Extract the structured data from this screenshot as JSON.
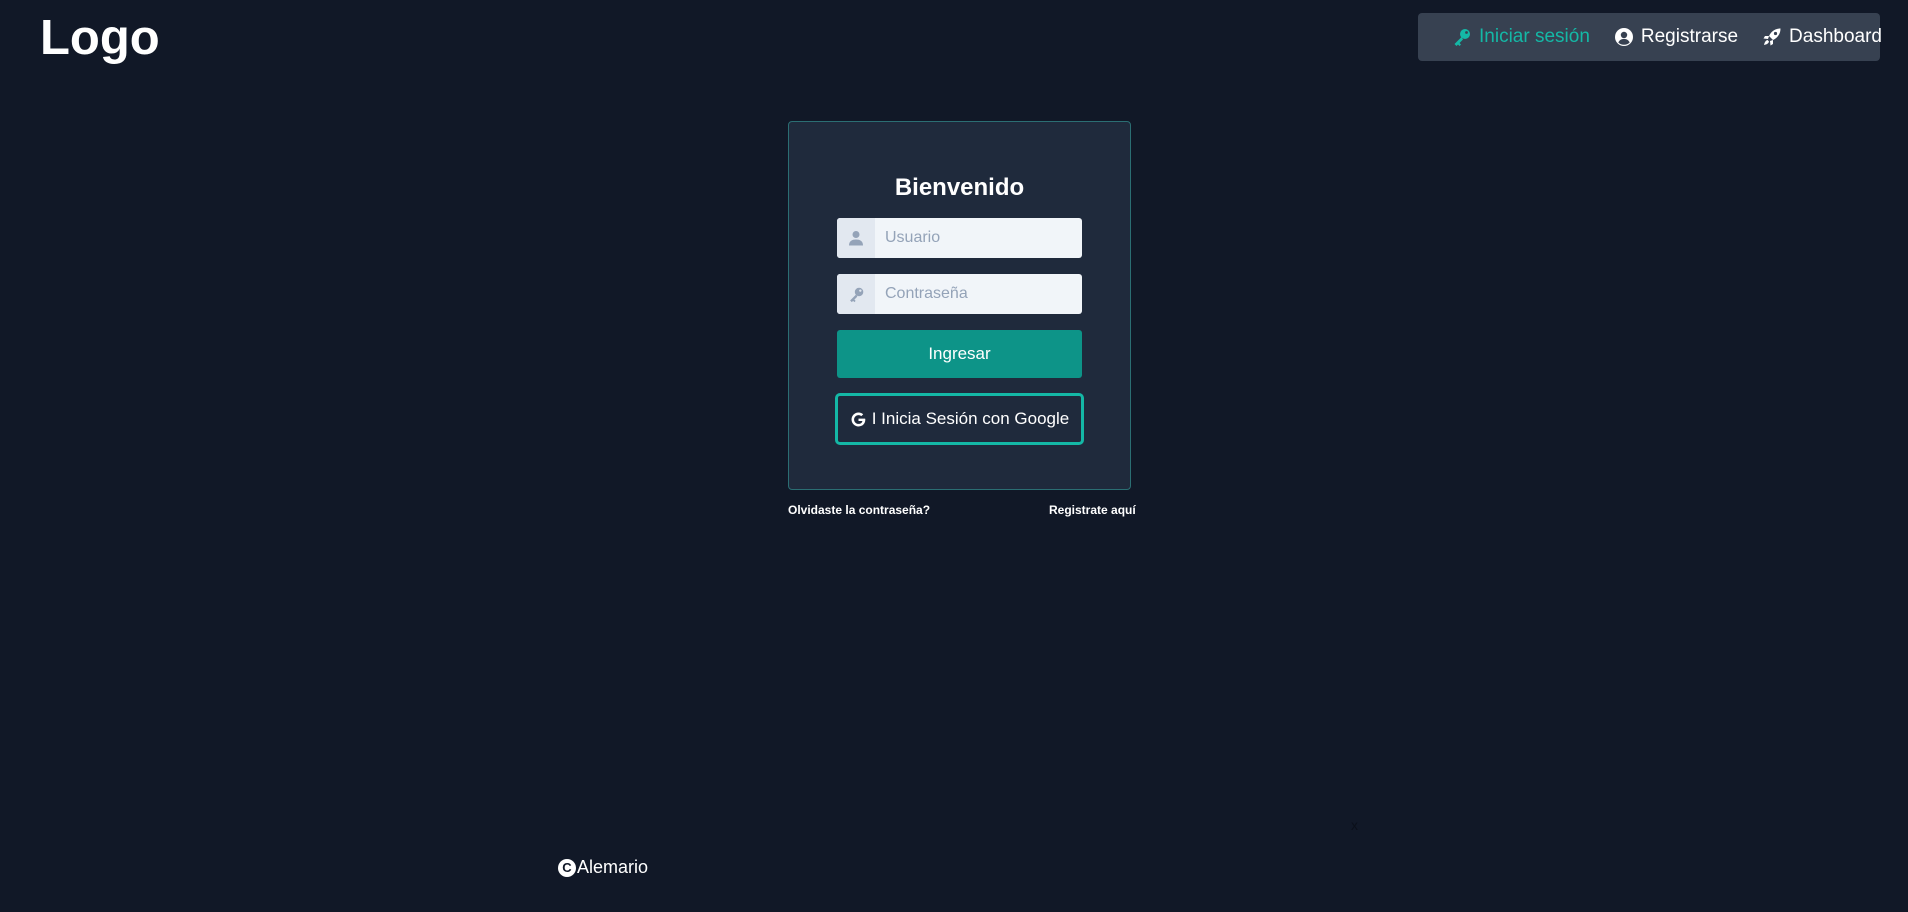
{
  "header": {
    "logo": "Logo",
    "nav": [
      {
        "label": "Iniciar sesión",
        "icon": "key-icon",
        "active": true
      },
      {
        "label": "Registrarse",
        "icon": "user-circle-icon",
        "active": false
      },
      {
        "label": "Dashboard",
        "icon": "rocket-icon",
        "active": false
      }
    ]
  },
  "login": {
    "title": "Bienvenido",
    "username_placeholder": "Usuario",
    "password_placeholder": "Contraseña",
    "submit_label": "Ingresar",
    "google_label": "I Inicia Sesión con Google",
    "forgot_link": "Olvidaste la contraseña?",
    "register_link": "Registrate aquí"
  },
  "footer": {
    "brand": "Alemario",
    "copyright_symbol": "C",
    "close_label": "x"
  },
  "colors": {
    "background": "#111827",
    "accent": "#14b8a6",
    "button": "#0d9488",
    "card": "#1f2a3c",
    "nav_background": "#374151"
  }
}
